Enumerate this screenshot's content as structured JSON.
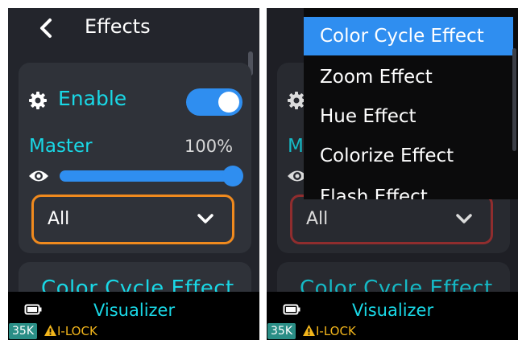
{
  "header": {
    "title": "Effects"
  },
  "enable": {
    "label": "Enable",
    "on": true
  },
  "master": {
    "label": "Master",
    "value": "100%",
    "level": 1.0
  },
  "dropdown": {
    "value": "All"
  },
  "next_card": {
    "label": "Color Cycle Effect"
  },
  "status": {
    "title": "Visualizer",
    "badge": "35K",
    "lock_label": "I-LOCK"
  },
  "popup": {
    "items": [
      {
        "label": "Color Cycle Effect",
        "selected": true
      },
      {
        "label": "Zoom Effect",
        "selected": false
      },
      {
        "label": "Hue Effect",
        "selected": false
      },
      {
        "label": "Colorize Effect",
        "selected": false
      },
      {
        "label": "Flash Effect",
        "selected": false
      }
    ]
  },
  "colors": {
    "background": "#23252c",
    "card": "#2f3239",
    "accent_text": "#19d8e6",
    "toggle_on": "#2f8ef0",
    "focus_border": "#f08a1e",
    "muted_border": "#a83536",
    "badge": "#2a8e86",
    "warning": "#f2b51b"
  },
  "icons": [
    "chevron-left-icon",
    "gear-icon",
    "eye-icon",
    "chevron-down-icon",
    "battery-icon",
    "warning-icon"
  ]
}
